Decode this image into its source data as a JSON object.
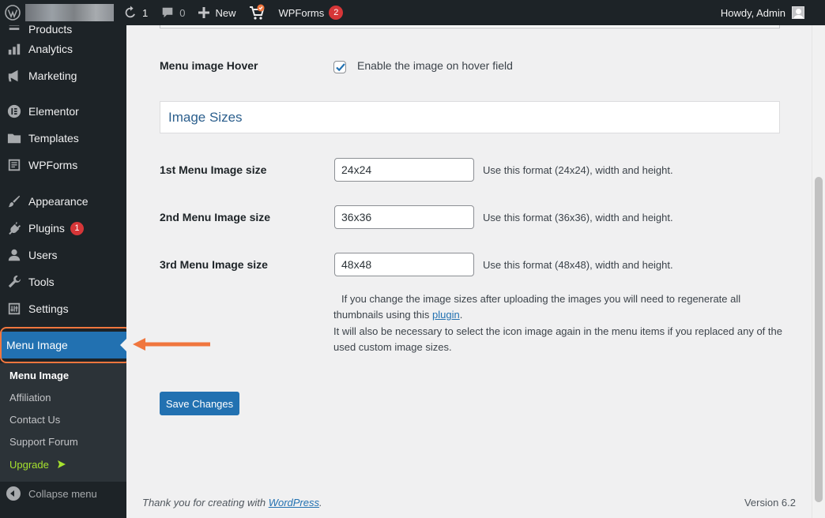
{
  "admin_bar": {
    "updates_count": "1",
    "comments_count": "0",
    "new_label": "New",
    "wpforms_label": "WPForms",
    "wpforms_badge": "2",
    "howdy": "Howdy, Admin"
  },
  "sidebar": {
    "items": [
      {
        "label": "Products",
        "icon": "products-icon"
      },
      {
        "label": "Analytics",
        "icon": "analytics-icon"
      },
      {
        "label": "Marketing",
        "icon": "megaphone-icon"
      },
      {
        "label": "Elementor",
        "icon": "elementor-icon"
      },
      {
        "label": "Templates",
        "icon": "folder-icon"
      },
      {
        "label": "WPForms",
        "icon": "wpforms-icon"
      },
      {
        "label": "Appearance",
        "icon": "brush-icon"
      },
      {
        "label": "Plugins",
        "icon": "plug-icon",
        "badge": "1"
      },
      {
        "label": "Users",
        "icon": "user-icon"
      },
      {
        "label": "Tools",
        "icon": "wrench-icon"
      },
      {
        "label": "Settings",
        "icon": "sliders-icon"
      }
    ],
    "current": {
      "label": "Menu Image",
      "icon": "menu-lines-icon"
    },
    "submenu": [
      "Menu Image",
      "Affiliation",
      "Contact Us",
      "Support Forum",
      "Upgrade"
    ],
    "collapse_label": "Collapse menu"
  },
  "colors": {
    "admin_bg": "#1d2327",
    "accent": "#2271b1",
    "highlight": "#f0763e",
    "badge": "#d63638",
    "upgrade": "#a6e22e"
  },
  "content": {
    "hover_label": "Menu image Hover",
    "hover_checked": true,
    "hover_checkbox_label": "Enable the image on hover field",
    "section_title": "Image Sizes",
    "sizes": [
      {
        "label": "1st Menu Image size",
        "value": "24x24",
        "desc": "Use this format (24x24), width and height."
      },
      {
        "label": "2nd Menu Image size",
        "value": "36x36",
        "desc": "Use this format (36x36), width and height."
      },
      {
        "label": "3rd Menu Image size",
        "value": "48x48",
        "desc": "Use this format (48x48), width and height."
      }
    ],
    "note1_before": "If you change the image sizes after uploading the images you will need to regenerate all thumbnails using this",
    "note1_link": "plugin",
    "note1_after": ".",
    "note2": "It will also be necessary to select the icon image again in the menu items if you replaced any of the used custom image sizes.",
    "save_label": "Save Changes"
  },
  "footer": {
    "thanks_before": "Thank you for creating with",
    "thanks_link": "WordPress",
    "thanks_after": ".",
    "version": "Version 6.2"
  }
}
